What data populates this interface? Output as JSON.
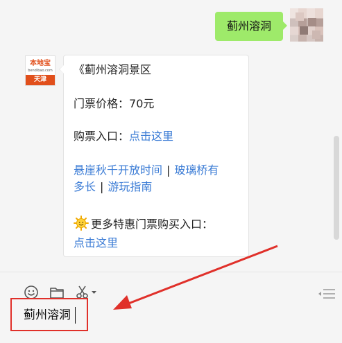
{
  "outgoing": {
    "text": "蓟州溶洞"
  },
  "incoming": {
    "avatar": {
      "brand": "本地宝",
      "url": "bendibao.com",
      "city": "天津"
    },
    "title": "《蓟州溶洞景区",
    "price_label": "门票价格：",
    "price_value": "70元",
    "buy_label": "购票入口：",
    "buy_link": "点击这里",
    "links_row1": [
      "悬崖秋千开放时间",
      "玻璃桥有"
    ],
    "links_row2": [
      "多长",
      "游玩指南"
    ],
    "separator": "|",
    "discount_label": "更多特惠门票购买入口：",
    "discount_link": "点击这里"
  },
  "toolbar": {
    "icons": [
      "emoji-icon",
      "folder-icon",
      "scissors-icon",
      "history-icon"
    ]
  },
  "input": {
    "value": "蓟州溶洞"
  },
  "colors": {
    "outgoing_bubble": "#9eea6a",
    "link": "#3a7bd5",
    "highlight": "#e0302a",
    "brand": "#e14f1b"
  }
}
